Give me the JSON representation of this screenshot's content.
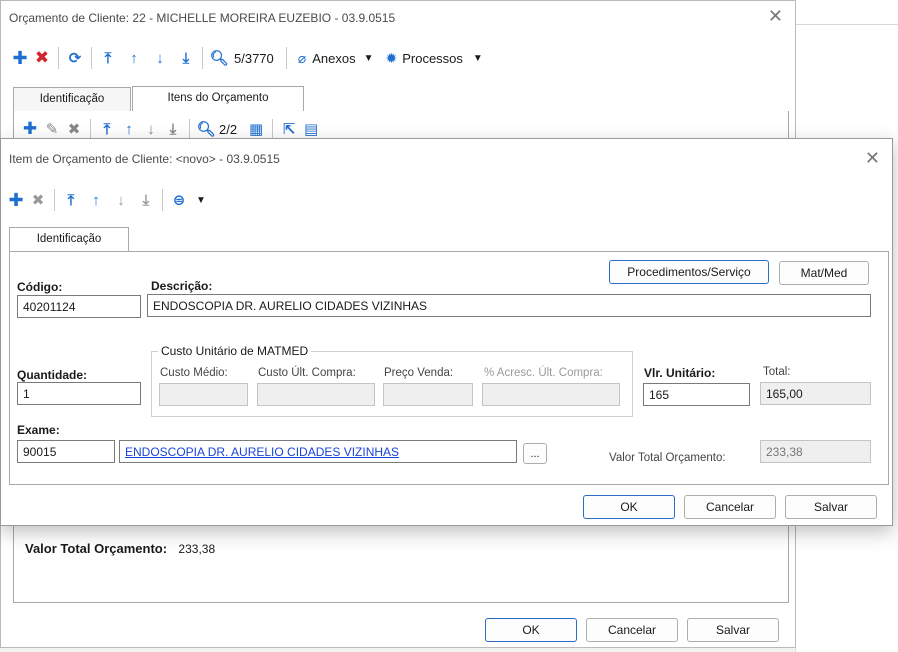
{
  "main_window": {
    "title": "Orçamento de Cliente: 22 - MICHELLE MOREIRA EUZEBIO - 03.9.0515",
    "toolbar": {
      "record_counter": "5/3770",
      "anexos_label": "Anexos",
      "processos_label": "Processos"
    },
    "tabs": [
      "Identificação",
      "Itens do Orçamento"
    ],
    "sub_toolbar": {
      "record_counter": "2/2"
    },
    "valor_total_label": "Valor Total Orçamento:",
    "valor_total_value": "233,38",
    "buttons": {
      "ok": "OK",
      "cancelar": "Cancelar",
      "salvar": "Salvar"
    }
  },
  "dialog": {
    "title": "Item de Orçamento de Cliente: <novo> - 03.9.0515",
    "tab": "Identificação",
    "buttons_top": {
      "procedimentos": "Procedimentos/Serviço",
      "matmed": "Mat/Med"
    },
    "codigo_label": "Código:",
    "codigo_value": "40201124",
    "descricao_label": "Descrição:",
    "descricao_value": "ENDOSCOPIA DR. AURELIO CIDADES VIZINHAS",
    "quantidade_label": "Quantidade:",
    "quantidade_value": "1",
    "custo_group_label": "Custo Unitário de MATMED",
    "custo_medio_label": "Custo Médio:",
    "custo_ult_compra_label": "Custo Últ. Compra:",
    "preco_venda_label": "Preço Venda:",
    "acresc_label": "% Acresc. Últ. Compra:",
    "vlr_unitario_label": "Vlr. Unitário:",
    "vlr_unitario_value": "165",
    "total_label": "Total:",
    "total_value": "165,00",
    "exame_label": "Exame:",
    "exame_code": "90015",
    "exame_desc": "ENDOSCOPIA DR. AURELIO CIDADES VIZINHAS",
    "ellipsis": "...",
    "valor_total_label": "Valor Total Orçamento:",
    "valor_total_value": "233,38",
    "buttons": {
      "ok": "OK",
      "cancelar": "Cancelar",
      "salvar": "Salvar"
    }
  },
  "colors": {
    "add": "#1f6fd0",
    "delete": "#d2262f",
    "accent": "#2b6cc4"
  },
  "icons": [
    "plus-icon",
    "x-icon",
    "refresh-icon",
    "first-icon",
    "up-arrow-icon",
    "down-arrow-icon",
    "last-icon",
    "search-icon",
    "paperclip-icon",
    "gear-icon",
    "edit-icon",
    "grid-icon",
    "export-icon",
    "document-icon",
    "disk-icon"
  ]
}
